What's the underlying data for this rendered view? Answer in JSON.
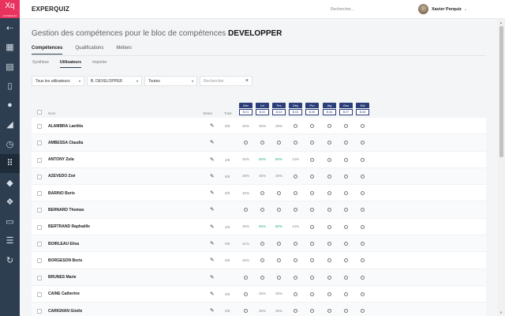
{
  "app": {
    "logo": "Xq",
    "logo_sub": "EXPERQUIZ",
    "brand": "EXPERQUIZ"
  },
  "header": {
    "search_placeholder": "Rechercher...",
    "user_name": "Xavier Perquiz",
    "caret": "⌄"
  },
  "sidebar": {
    "icons": [
      "back-arrow-icon",
      "dashboard-icon",
      "document-icon",
      "file-icon",
      "user-icon",
      "chart-icon",
      "clock-icon",
      "skills-grid-icon",
      "graduation-cap-icon",
      "cubes-icon",
      "id-card-icon",
      "list-icon",
      "sync-icon"
    ],
    "active_index": 7
  },
  "page": {
    "title_prefix": "Gestion des compétences pour le bloc de compétences",
    "title_block": "DEVELOPPER"
  },
  "tabs": [
    {
      "label": "Compétences",
      "active": true
    },
    {
      "label": "Qualifications",
      "active": false
    },
    {
      "label": "Métiers",
      "active": false
    }
  ],
  "subtabs": [
    {
      "label": "Synthèse",
      "active": false
    },
    {
      "label": "Utilisateurs",
      "active": true
    },
    {
      "label": "Importer",
      "active": false
    }
  ],
  "filters": {
    "users": "Tous les utilisateurs",
    "block": "B. DEVELOPPER",
    "items": "Toutes",
    "search_placeholder": "Rechercher",
    "clear": "×",
    "caret": "▾"
  },
  "table": {
    "headers": {
      "name": "Nom",
      "status": "Statut",
      "total": "Total"
    },
    "competences": [
      {
        "abbr": "Dév",
        "code": "B.01"
      },
      {
        "abbr": "Int",
        "code": "B.02"
      },
      {
        "abbr": "Tes",
        "code": "B.03"
      },
      {
        "abbr": "Dép",
        "code": "B.04"
      },
      {
        "abbr": "Pro",
        "code": "B.05"
      },
      {
        "abbr": "Alg",
        "code": "B.06"
      },
      {
        "abbr": "Geo",
        "code": "B.07"
      },
      {
        "abbr": "Edi",
        "code": "B.08"
      }
    ],
    "rows": [
      {
        "name": "ALAMBRA Laetitia",
        "total": "0/8",
        "cells": [
          "45%",
          "35%",
          "26%",
          "o",
          "o",
          "o",
          "o",
          "o"
        ]
      },
      {
        "name": "AMBESSA Claudia",
        "total": "",
        "cells": [
          "o",
          "o",
          "o",
          "o",
          "o",
          "o",
          "o",
          "o"
        ]
      },
      {
        "name": "ANTONY Zula",
        "total": "2/8",
        "cells": [
          "45%",
          "65%",
          "80%",
          "14%",
          "o",
          "o",
          "o",
          "o"
        ]
      },
      {
        "name": "AZEVEDO Zoé",
        "total": "0/8",
        "cells": [
          "45%",
          "35%",
          "26%",
          "o",
          "o",
          "o",
          "o",
          "o"
        ]
      },
      {
        "name": "BARINO Boris",
        "total": "0/8",
        "cells": [
          "45%",
          "o",
          "o",
          "o",
          "o",
          "o",
          "o",
          "o"
        ]
      },
      {
        "name": "BERNARD Thomas",
        "total": "",
        "cells": [
          "o",
          "o",
          "o",
          "o",
          "o",
          "o",
          "o",
          "o"
        ]
      },
      {
        "name": "BERTRAND Raphaëlle",
        "total": "2/8",
        "cells": [
          "45%",
          "65%",
          "80%",
          "14%",
          "o",
          "o",
          "o",
          "o"
        ]
      },
      {
        "name": "BOIRLEAU Elisa",
        "total": "0/8",
        "cells": [
          "41%",
          "o",
          "o",
          "o",
          "o",
          "o",
          "o",
          "o"
        ]
      },
      {
        "name": "BORGESON Boris",
        "total": "0/8",
        "cells": [
          "45%",
          "o",
          "o",
          "o",
          "o",
          "o",
          "o",
          "o"
        ]
      },
      {
        "name": "BRUNES Marie",
        "total": "",
        "cells": [
          "o",
          "o",
          "o",
          "o",
          "o",
          "o",
          "o",
          "o"
        ]
      },
      {
        "name": "CAINE Catherine",
        "total": "0/8",
        "cells": [
          "o",
          "35%",
          "26%",
          "o",
          "o",
          "o",
          "o",
          "o"
        ]
      },
      {
        "name": "CARIGNAN Gisèle",
        "total": "0/8",
        "cells": [
          "o",
          "35%",
          "26%",
          "o",
          "o",
          "o",
          "o",
          "o"
        ]
      }
    ],
    "green_values": [
      "65%",
      "80%"
    ]
  },
  "scroll": {
    "up": "▲",
    "down": "▼"
  }
}
